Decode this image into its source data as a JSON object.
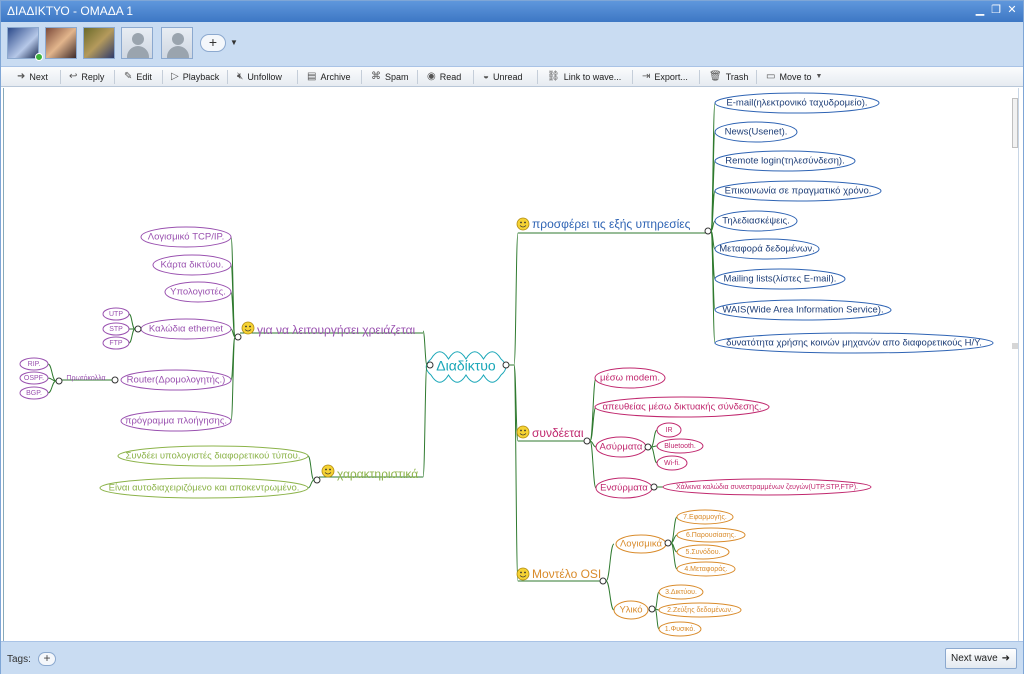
{
  "window": {
    "title": "ΔΙΑΔΙΚΤΥΟ - ΟΜΑΔΑ 1"
  },
  "participants": {
    "add_label": "+"
  },
  "toolbar": {
    "next": "Next",
    "reply": "Reply",
    "edit": "Edit",
    "playback": "Playback",
    "unfollow": "Unfollow",
    "archive": "Archive",
    "spam": "Spam",
    "read": "Read",
    "unread": "Unread",
    "link": "Link to wave...",
    "export": "Export...",
    "trash": "Trash",
    "moveto": "Move to"
  },
  "mindmap": {
    "central": "Διαδίκτυο",
    "branch_services": "προσφέρει τις εξής υπηρεσίες",
    "services": [
      "E-mail(ηλεκτρονικό ταχυδρομείο).",
      "News(Usenet).",
      "Remote login(τηλεσύνδεση).",
      "Επικοινωνία σε πραγματικό χρόνο.",
      "Τηλεδιασκέψεις.",
      "Μεταφορά δεδομένων.",
      "Mailing lists(λίστες E-mail).",
      "WAIS(Wide Area Information Service).",
      "δυνατότητα χρήσης κοινών μηχανών απο διαφορετικούς Η/Υ."
    ],
    "branch_connect": "συνδέεται",
    "connect_modem": "μέσω modem.",
    "connect_direct": "απευθείας μέσω δικτυακής σύνδεσης.",
    "connect_wireless": "Ασύρματα",
    "wireless": [
      "IR",
      "Bluetooth.",
      "Wi-fi."
    ],
    "connect_wired": "Ενσύρματα",
    "wired_detail": "Χάλκινα καλώδια συνεστραμμένων ζευγών(UTP,STP,FTP).",
    "branch_osi": "Μοντέλο OSI",
    "osi_software": "Λογισμικά",
    "software_layers": [
      "7.Εφαρμογής.",
      "6.Παρουσίασης.",
      "5.Συνόδου.",
      "4.Μεταφοράς."
    ],
    "osi_hardware": "Υλικό",
    "hardware_layers": [
      "3.Δικτύου.",
      "2.Ζεύξης δεδομένων.",
      "1.Φυσικό."
    ],
    "branch_needs": "για να λειτουργήσει χρειάζεται",
    "needs": [
      "Λογισμικό TCP/IP.",
      "Κάρτα δικτύου.",
      "Υπολογιστές.",
      "Καλώδια ethernet",
      "Router(Δρομολογητής.)",
      "πρόγραμμα πλοήγησης."
    ],
    "cables": [
      "UTP",
      "STP",
      "FTP"
    ],
    "protocols_label": "Πρωτόκολλα",
    "protocols": [
      "RIP.",
      "OSPF.",
      "BGP."
    ],
    "branch_features": "χαρακτηριστικά",
    "features": [
      "Συνδέει υπολογιστές διαφορετικού τύπου.",
      "Είναι αυτοδιαχειριζόμενο και αποκεντρωμένο."
    ]
  },
  "bottom": {
    "tags": "Tags:",
    "tags_add": "+",
    "next_wave": "Next wave"
  },
  "colors": {
    "services": "#2f64b4",
    "connect": "#c0286e",
    "osi": "#d98b2b",
    "needs": "#9a52b0",
    "features": "#8cb34a",
    "central": "#1aa7b8",
    "lines": "#2f7a2f"
  }
}
